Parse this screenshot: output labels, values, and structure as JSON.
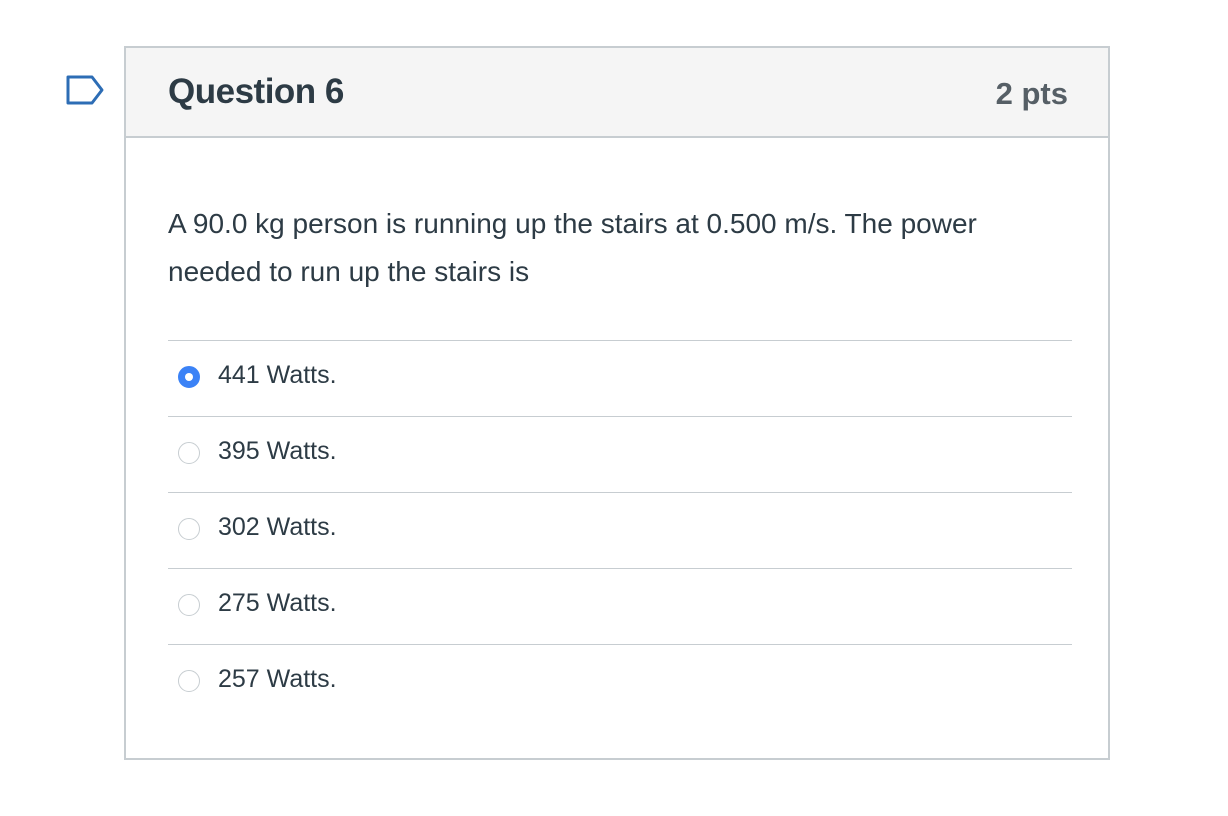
{
  "question": {
    "title": "Question 6",
    "points": "2 pts",
    "text": "A 90.0 kg person is running up the stairs at 0.500 m/s. The power needed to run up the stairs is",
    "flag_icon": "flag-icon"
  },
  "answers": [
    {
      "label": "441 Watts.",
      "selected": true
    },
    {
      "label": "395 Watts.",
      "selected": false
    },
    {
      "label": "302 Watts.",
      "selected": false
    },
    {
      "label": "275 Watts.",
      "selected": false
    },
    {
      "label": "257 Watts.",
      "selected": false
    }
  ],
  "colors": {
    "selected_radio": "#3b82f6",
    "border": "#c7cdd1",
    "header_bg": "#f5f5f5",
    "text": "#2d3b45",
    "flag": "#2d6db5"
  }
}
